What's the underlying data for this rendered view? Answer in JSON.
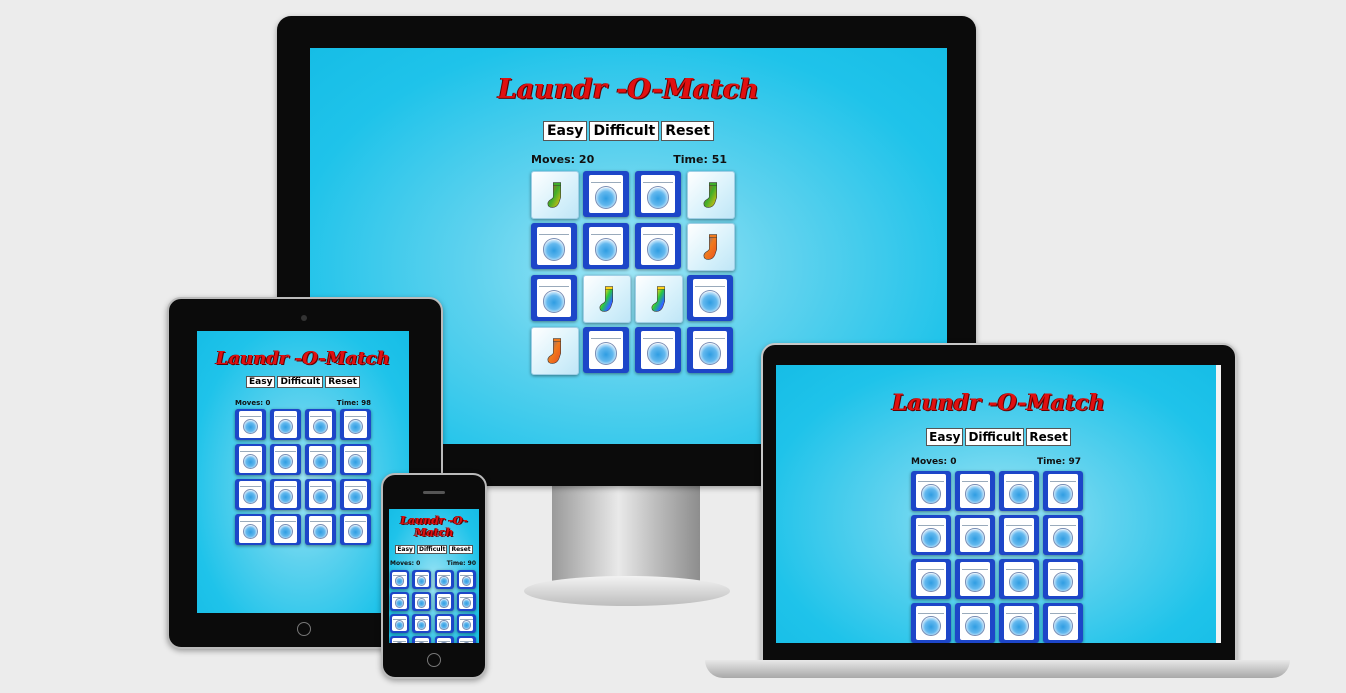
{
  "devices": {
    "desktop": {
      "title": "Laundr -O-Match",
      "buttons": [
        "Easy",
        "Difficult",
        "Reset"
      ],
      "moves": "Moves: 20",
      "time": "Time: 51",
      "cards": [
        "sock-red",
        "wm",
        "wm",
        "sock-red",
        "wm",
        "wm",
        "wm",
        "sock-orange",
        "wm",
        "sock-rainbow",
        "sock-rainbow",
        "wm",
        "sock-orange",
        "wm",
        "wm",
        "wm"
      ]
    },
    "tablet": {
      "title": "Laundr -O-Match",
      "buttons": [
        "Easy",
        "Difficult",
        "Reset"
      ],
      "moves": "Moves: 0",
      "time": "Time: 98"
    },
    "phone": {
      "title": "Laundr -O-Match",
      "buttons": [
        "Easy",
        "Difficult",
        "Reset"
      ],
      "moves": "Moves: 0",
      "time": "Time: 90"
    },
    "laptop": {
      "title": "Laundr -O-Match",
      "buttons": [
        "Easy",
        "Difficult",
        "Reset"
      ],
      "moves": "Moves: 0",
      "time": "Time: 97"
    }
  },
  "icons": {
    "face_down": "washing-machine-icon",
    "face_up": "sock-icon"
  },
  "colors": {
    "title": "#e01010",
    "card_back": "#1d46c8",
    "screen_bg": "#1fc3ea"
  }
}
